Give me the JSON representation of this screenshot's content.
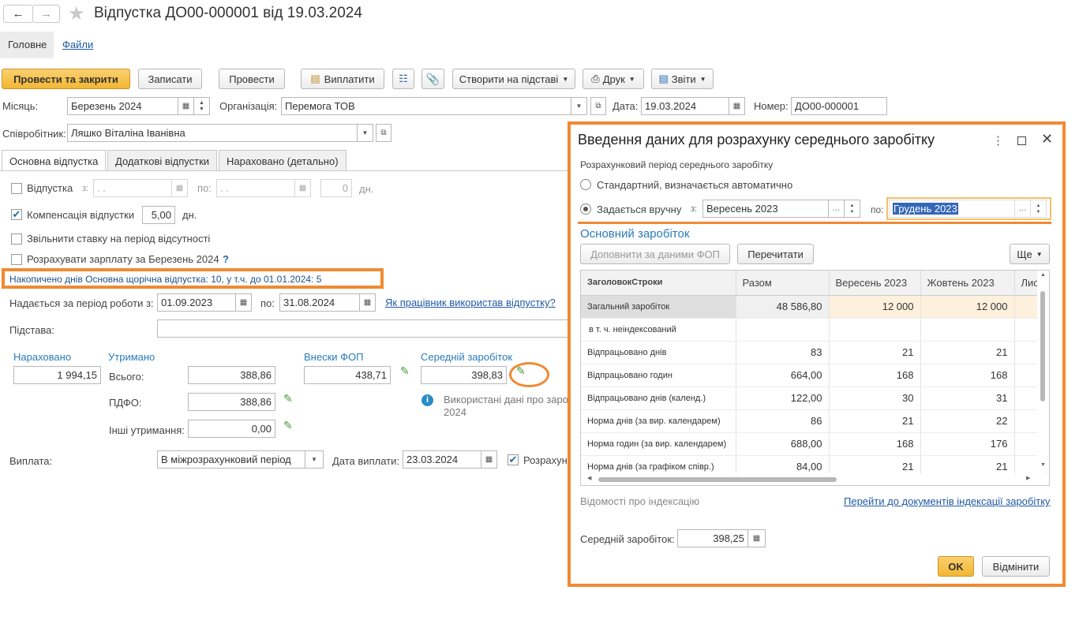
{
  "window": {
    "title": "Відпустка ДО00-000001 від 19.03.2024"
  },
  "nav": {
    "tab_main": "Головне",
    "tab_files": "Файли"
  },
  "toolbar": {
    "post_close": "Провести та закрити",
    "save": "Записати",
    "post": "Провести",
    "pay": "Виплатити",
    "create_based": "Створити на підставі",
    "print": "Друк",
    "reports": "Звіти"
  },
  "header": {
    "month_label": "Місяць:",
    "month_value": "Березень 2024",
    "org_label": "Організація:",
    "org_value": "Перемога ТОВ",
    "date_label": "Дата:",
    "date_value": "19.03.2024",
    "number_label": "Номер:",
    "number_value": "ДО00-000001",
    "employee_label": "Співробітник:",
    "employee_value": "Ляшко Віталіна Іванівна"
  },
  "tabs": [
    "Основна відпустка",
    "Додаткові відпустки",
    "Нараховано (детально)"
  ],
  "main": {
    "vacation_label": "Відпустка",
    "from_label": "з:",
    "from_value": " .  .",
    "to_label": "по:",
    "to_value": " .  .",
    "days_value": "0",
    "days_unit": "дн.",
    "compensation_label": "Компенсація відпустки",
    "compensation_value": "5,00",
    "compensation_unit": "дн.",
    "release_rate_label": "Звільнити ставку на період відсутності",
    "calc_salary_label": "Розрахувати зарплату за Березень 2024",
    "help_mark": "?",
    "accrued_days_note": "Накопичено днів Основна щорічна відпустка: 10, у т.ч. до 01.01.2024: 5",
    "period_label": "Надається за період роботи з:",
    "period_from": "01.09.2023",
    "period_to_label": "по:",
    "period_to": "31.08.2024",
    "used_link": "Як працівник використав відпустку?",
    "basis_label": "Підстава:",
    "accrued_title": "Нараховано",
    "accrued_value": "1 994,15",
    "withheld_title": "Утримано",
    "total_label": "Всього:",
    "total_value": "388,86",
    "pdfo_label": "ПДФО:",
    "pdfo_value": "388,86",
    "other_label": "Інші утримання:",
    "other_value": "0,00",
    "fop_title": "Внески ФОП",
    "fop_value": "438,71",
    "avg_title": "Середній заробіток",
    "avg_value": "398,83",
    "info_text_1": "Використані дані про зароб",
    "info_text_2": "2024",
    "payment_label": "Виплата:",
    "payment_value": "В міжрозрахунковий період",
    "pay_date_label": "Дата виплати:",
    "pay_date_value": "23.03.2024",
    "calc_check_label": "Розрахун"
  },
  "dialog": {
    "title": "Введення даних для розрахунку середнього заробітку",
    "period_caption": "Розрахунковий період середнього заробітку",
    "radio_standard": "Стандартний, визначається автоматично",
    "radio_manual": "Задається вручну",
    "from_label": "з:",
    "from_value": "Вересень 2023",
    "to_label": "по:",
    "to_value": "Грудень 2023",
    "section_title": "Основний заробіток",
    "fill_button": "Доповнити за даними ФОП",
    "reread_button": "Перечитати",
    "more_button": "Ще",
    "columns": [
      "ЗаголовокСтроки",
      "Разом",
      "Вересень 2023",
      "Жовтень 2023",
      "Лис"
    ],
    "rows": [
      {
        "label": "Загальний заробіток",
        "total": "48 586,80",
        "sep": "12 000",
        "oct": "12 000"
      },
      {
        "label": "в т. ч. неіндексований",
        "total": "",
        "sep": "",
        "oct": ""
      },
      {
        "label": "Відпрацьовано днів",
        "total": "83",
        "sep": "21",
        "oct": "21"
      },
      {
        "label": "Відпрацьовано годин",
        "total": "664,00",
        "sep": "168",
        "oct": "168"
      },
      {
        "label": "Відпрацьовано днів (календ.)",
        "total": "122,00",
        "sep": "30",
        "oct": "31"
      },
      {
        "label": "Норма днів (за вир. календарем)",
        "total": "86",
        "sep": "21",
        "oct": "22"
      },
      {
        "label": "Норма годин (за вир. календарем)",
        "total": "688,00",
        "sep": "168",
        "oct": "176"
      },
      {
        "label": "Норма днів (за графіком співр.)",
        "total": "84,00",
        "sep": "21",
        "oct": "21"
      }
    ],
    "indexation_label": "Відомості про індексацію",
    "indexation_link": "Перейти до документів індексації заробітку",
    "avg_label": "Середній заробіток:",
    "avg_value": "398,25",
    "ok": "OK",
    "cancel": "Відмінити"
  },
  "colors": {
    "accent_orange": "#f08a33",
    "primary_button": "#f2b633",
    "link_blue": "#1f5aa6"
  }
}
